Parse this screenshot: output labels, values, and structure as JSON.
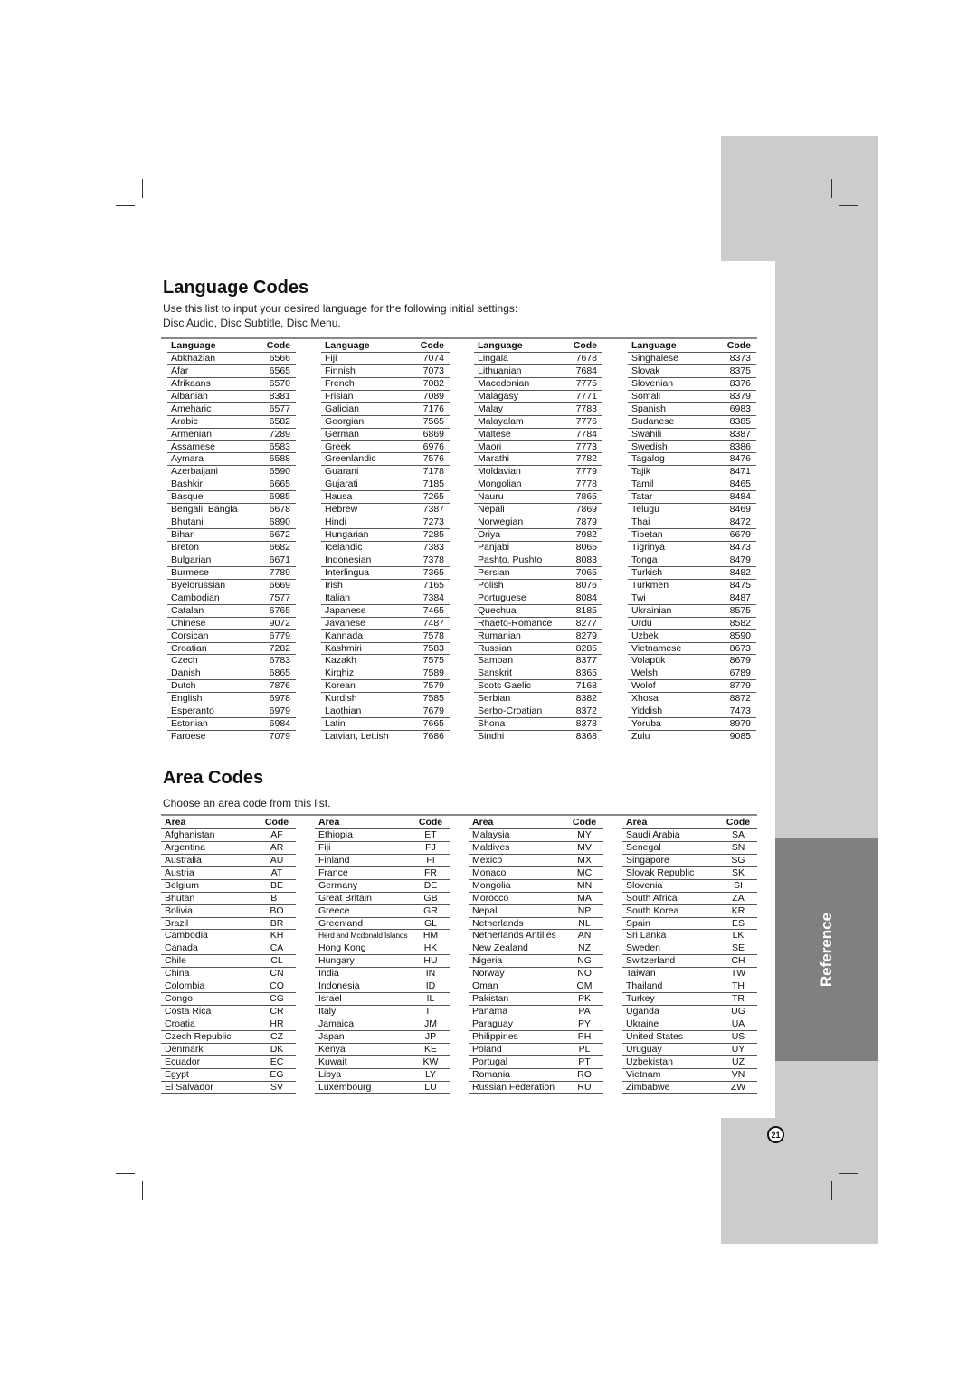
{
  "side_tab": {
    "label": "Reference"
  },
  "page_number": "21",
  "language_codes": {
    "title": "Language Codes",
    "intro_line1": "Use this list to input your desired language for the following initial settings:",
    "intro_line2": "Disc Audio, Disc Subtitle, Disc Menu.",
    "header": {
      "name": "Language",
      "code": "Code"
    },
    "columns": [
      [
        [
          "Abkhazian",
          "6566"
        ],
        [
          "Afar",
          "6565"
        ],
        [
          "Afrikaans",
          "6570"
        ],
        [
          "Albanian",
          "8381"
        ],
        [
          "Ameharic",
          "6577"
        ],
        [
          "Arabic",
          "6582"
        ],
        [
          "Armenian",
          "7289"
        ],
        [
          "Assamese",
          "6583"
        ],
        [
          "Aymara",
          "6588"
        ],
        [
          "Azerbaijani",
          "6590"
        ],
        [
          "Bashkir",
          "6665"
        ],
        [
          "Basque",
          "6985"
        ],
        [
          "Bengali; Bangla",
          "6678"
        ],
        [
          "Bhutani",
          "6890"
        ],
        [
          "Bihari",
          "6672"
        ],
        [
          "Breton",
          "6682"
        ],
        [
          "Bulgarian",
          "6671"
        ],
        [
          "Burmese",
          "7789"
        ],
        [
          "Byelorussian",
          "6669"
        ],
        [
          "Cambodian",
          "7577"
        ],
        [
          "Catalan",
          "6765"
        ],
        [
          "Chinese",
          "9072"
        ],
        [
          "Corsican",
          "6779"
        ],
        [
          "Croatian",
          "7282"
        ],
        [
          "Czech",
          "6783"
        ],
        [
          "Danish",
          "6865"
        ],
        [
          "Dutch",
          "7876"
        ],
        [
          "English",
          "6978"
        ],
        [
          "Esperanto",
          "6979"
        ],
        [
          "Estonian",
          "6984"
        ],
        [
          "Faroese",
          "7079"
        ]
      ],
      [
        [
          "Fiji",
          "7074"
        ],
        [
          "Finnish",
          "7073"
        ],
        [
          "French",
          "7082"
        ],
        [
          "Frisian",
          "7089"
        ],
        [
          "Galician",
          "7176"
        ],
        [
          "Georgian",
          "7565"
        ],
        [
          "German",
          "6869"
        ],
        [
          "Greek",
          "6976"
        ],
        [
          "Greenlandic",
          "7576"
        ],
        [
          "Guarani",
          "7178"
        ],
        [
          "Gujarati",
          "7185"
        ],
        [
          "Hausa",
          "7265"
        ],
        [
          "Hebrew",
          "7387"
        ],
        [
          "Hindi",
          "7273"
        ],
        [
          "Hungarian",
          "7285"
        ],
        [
          "Icelandic",
          "7383"
        ],
        [
          "Indonesian",
          "7378"
        ],
        [
          "Interlingua",
          "7365"
        ],
        [
          "Irish",
          "7165"
        ],
        [
          "Italian",
          "7384"
        ],
        [
          "Japanese",
          "7465"
        ],
        [
          "Javanese",
          "7487"
        ],
        [
          "Kannada",
          "7578"
        ],
        [
          "Kashmiri",
          "7583"
        ],
        [
          "Kazakh",
          "7575"
        ],
        [
          "Kirghiz",
          "7589"
        ],
        [
          "Korean",
          "7579"
        ],
        [
          "Kurdish",
          "7585"
        ],
        [
          "Laothian",
          "7679"
        ],
        [
          "Latin",
          "7665"
        ],
        [
          "Latvian, Lettish",
          "7686"
        ]
      ],
      [
        [
          "Lingala",
          "7678"
        ],
        [
          "Lithuanian",
          "7684"
        ],
        [
          "Macedonian",
          "7775"
        ],
        [
          "Malagasy",
          "7771"
        ],
        [
          "Malay",
          "7783"
        ],
        [
          "Malayalam",
          "7776"
        ],
        [
          "Maltese",
          "7784"
        ],
        [
          "Maori",
          "7773"
        ],
        [
          "Marathi",
          "7782"
        ],
        [
          "Moldavian",
          "7779"
        ],
        [
          "Mongolian",
          "7778"
        ],
        [
          "Nauru",
          "7865"
        ],
        [
          "Nepali",
          "7869"
        ],
        [
          "Norwegian",
          "7879"
        ],
        [
          "Oriya",
          "7982"
        ],
        [
          "Panjabi",
          "8065"
        ],
        [
          "Pashto, Pushto",
          "8083"
        ],
        [
          "Persian",
          "7065"
        ],
        [
          "Polish",
          "8076"
        ],
        [
          "Portuguese",
          "8084"
        ],
        [
          "Quechua",
          "8185"
        ],
        [
          "Rhaeto-Romance",
          "8277"
        ],
        [
          "Rumanian",
          "8279"
        ],
        [
          "Russian",
          "8285"
        ],
        [
          "Samoan",
          "8377"
        ],
        [
          "Sanskrit",
          "8365"
        ],
        [
          "Scots Gaelic",
          "7168"
        ],
        [
          "Serbian",
          "8382"
        ],
        [
          "Serbo-Croatian",
          "8372"
        ],
        [
          "Shona",
          "8378"
        ],
        [
          "Sindhi",
          "8368"
        ]
      ],
      [
        [
          "Singhalese",
          "8373"
        ],
        [
          "Slovak",
          "8375"
        ],
        [
          "Slovenian",
          "8376"
        ],
        [
          "Somali",
          "8379"
        ],
        [
          "Spanish",
          "6983"
        ],
        [
          "Sudanese",
          "8385"
        ],
        [
          "Swahili",
          "8387"
        ],
        [
          "Swedish",
          "8386"
        ],
        [
          "Tagalog",
          "8476"
        ],
        [
          "Tajik",
          "8471"
        ],
        [
          "Tamil",
          "8465"
        ],
        [
          "Tatar",
          "8484"
        ],
        [
          "Telugu",
          "8469"
        ],
        [
          "Thai",
          "8472"
        ],
        [
          "Tibetan",
          "6679"
        ],
        [
          "Tigrinya",
          "8473"
        ],
        [
          "Tonga",
          "8479"
        ],
        [
          "Turkish",
          "8482"
        ],
        [
          "Turkmen",
          "8475"
        ],
        [
          "Twi",
          "8487"
        ],
        [
          "Ukrainian",
          "8575"
        ],
        [
          "Urdu",
          "8582"
        ],
        [
          "Uzbek",
          "8590"
        ],
        [
          "Vietnamese",
          "8673"
        ],
        [
          "Volapük",
          "8679"
        ],
        [
          "Welsh",
          "6789"
        ],
        [
          "Wolof",
          "8779"
        ],
        [
          "Xhosa",
          "8872"
        ],
        [
          "Yiddish",
          "7473"
        ],
        [
          "Yoruba",
          "8979"
        ],
        [
          "Zulu",
          "9085"
        ]
      ]
    ]
  },
  "area_codes": {
    "title": "Area Codes",
    "intro": "Choose an area code from this list.",
    "header": {
      "name": "Area",
      "code": "Code"
    },
    "columns": [
      [
        [
          "Afghanistan",
          "AF"
        ],
        [
          "Argentina",
          "AR"
        ],
        [
          "Australia",
          "AU"
        ],
        [
          "Austria",
          "AT"
        ],
        [
          "Belgium",
          "BE"
        ],
        [
          "Bhutan",
          "BT"
        ],
        [
          "Bolivia",
          "BO"
        ],
        [
          "Brazil",
          "BR"
        ],
        [
          "Cambodia",
          "KH"
        ],
        [
          "Canada",
          "CA"
        ],
        [
          "Chile",
          "CL"
        ],
        [
          "China",
          "CN"
        ],
        [
          "Colombia",
          "CO"
        ],
        [
          "Congo",
          "CG"
        ],
        [
          "Costa Rica",
          "CR"
        ],
        [
          "Croatia",
          "HR"
        ],
        [
          "Czech Republic",
          "CZ"
        ],
        [
          "Denmark",
          "DK"
        ],
        [
          "Ecuador",
          "EC"
        ],
        [
          "Egypt",
          "EG"
        ],
        [
          "El Salvador",
          "SV"
        ]
      ],
      [
        [
          "Ethiopia",
          "ET"
        ],
        [
          "Fiji",
          "FJ"
        ],
        [
          "Finland",
          "FI"
        ],
        [
          "France",
          "FR"
        ],
        [
          "Germany",
          "DE"
        ],
        [
          "Great Britain",
          "GB"
        ],
        [
          "Greece",
          "GR"
        ],
        [
          "Greenland",
          "GL"
        ],
        [
          "Herd and Mcdonald Islands",
          "HM"
        ],
        [
          "Hong Kong",
          "HK"
        ],
        [
          "Hungary",
          "HU"
        ],
        [
          "India",
          "IN"
        ],
        [
          "Indonesia",
          "ID"
        ],
        [
          "Israel",
          "IL"
        ],
        [
          "Italy",
          "IT"
        ],
        [
          "Jamaica",
          "JM"
        ],
        [
          "Japan",
          "JP"
        ],
        [
          "Kenya",
          "KE"
        ],
        [
          "Kuwait",
          "KW"
        ],
        [
          "Libya",
          "LY"
        ],
        [
          "Luxembourg",
          "LU"
        ]
      ],
      [
        [
          "Malaysia",
          "MY"
        ],
        [
          "Maldives",
          "MV"
        ],
        [
          "Mexico",
          "MX"
        ],
        [
          "Monaco",
          "MC"
        ],
        [
          "Mongolia",
          "MN"
        ],
        [
          "Morocco",
          "MA"
        ],
        [
          "Nepal",
          "NP"
        ],
        [
          "Netherlands",
          "NL"
        ],
        [
          "Netherlands Antilles",
          "AN"
        ],
        [
          "New Zealand",
          "NZ"
        ],
        [
          "Nigeria",
          "NG"
        ],
        [
          "Norway",
          "NO"
        ],
        [
          "Oman",
          "OM"
        ],
        [
          "Pakistan",
          "PK"
        ],
        [
          "Panama",
          "PA"
        ],
        [
          "Paraguay",
          "PY"
        ],
        [
          "Philippines",
          "PH"
        ],
        [
          "Poland",
          "PL"
        ],
        [
          "Portugal",
          "PT"
        ],
        [
          "Romania",
          "RO"
        ],
        [
          "Russian Federation",
          "RU"
        ]
      ],
      [
        [
          "Saudi Arabia",
          "SA"
        ],
        [
          "Senegal",
          "SN"
        ],
        [
          "Singapore",
          "SG"
        ],
        [
          "Slovak Republic",
          "SK"
        ],
        [
          "Slovenia",
          "SI"
        ],
        [
          "South Africa",
          "ZA"
        ],
        [
          "South Korea",
          "KR"
        ],
        [
          "Spain",
          "ES"
        ],
        [
          "Sri Lanka",
          "LK"
        ],
        [
          "Sweden",
          "SE"
        ],
        [
          "Switzerland",
          "CH"
        ],
        [
          "Taiwan",
          "TW"
        ],
        [
          "Thailand",
          "TH"
        ],
        [
          "Turkey",
          "TR"
        ],
        [
          "Uganda",
          "UG"
        ],
        [
          "Ukraine",
          "UA"
        ],
        [
          "United States",
          "US"
        ],
        [
          "Uruguay",
          "UY"
        ],
        [
          "Uzbekistan",
          "UZ"
        ],
        [
          "Vietnam",
          "VN"
        ],
        [
          "Zimbabwe",
          "ZW"
        ]
      ]
    ]
  }
}
